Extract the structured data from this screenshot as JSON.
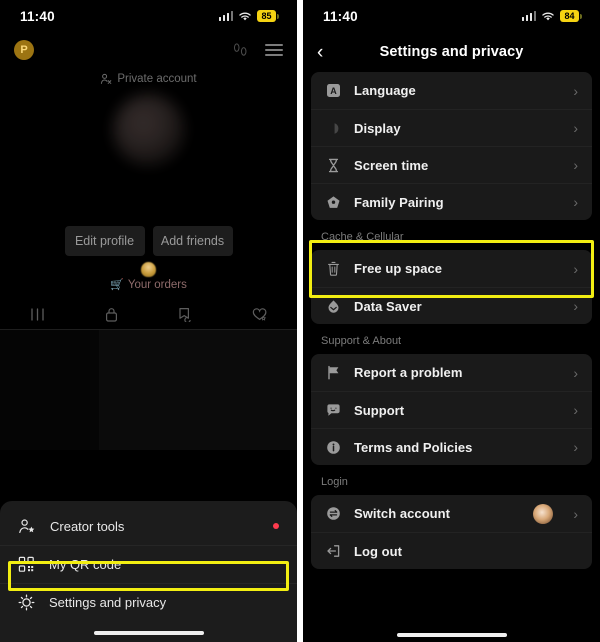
{
  "left_screen": {
    "status_bar": {
      "time": "11:40",
      "battery_level": "85",
      "battery_color": "#f5d312",
      "signal_icon": "cellular-bars-icon",
      "wifi_icon": "wifi-icon"
    },
    "header": {
      "badge_letter": "P",
      "username_redacted": "",
      "footprints_icon": "footprints-icon",
      "menu_icon": "hamburger-menu-icon"
    },
    "private_account_label": "Private account",
    "buttons": {
      "edit_profile": "Edit profile",
      "add_friends": "Add friends"
    },
    "orders_label": "Your orders",
    "tabs": [
      {
        "name": "posts-tab",
        "icon": "grid-icon"
      },
      {
        "name": "private-tab",
        "icon": "lock-icon"
      },
      {
        "name": "reposts-tab",
        "icon": "repost-icon"
      },
      {
        "name": "liked-tab",
        "icon": "heart-icon"
      }
    ],
    "sheet": {
      "items": [
        {
          "label": "Creator tools",
          "icon": "person-star-icon",
          "badge": true
        },
        {
          "label": "My QR code",
          "icon": "qr-code-icon",
          "badge": false
        },
        {
          "label": "Settings and privacy",
          "icon": "gear-icon",
          "badge": false
        }
      ]
    },
    "highlight_color": "#f2ee12"
  },
  "right_screen": {
    "status_bar": {
      "time": "11:40",
      "battery_level": "84",
      "battery_color": "#f5d312"
    },
    "nav": {
      "back_icon": "chevron-left-icon",
      "title": "Settings and privacy"
    },
    "groups": [
      {
        "header": "",
        "rows": [
          {
            "label": "Language",
            "icon": "language-letter-a-icon",
            "chevron": "›"
          },
          {
            "label": "Display",
            "icon": "moon-display-icon",
            "chevron": "›"
          },
          {
            "label": "Screen time",
            "icon": "hourglass-icon",
            "chevron": "›"
          },
          {
            "label": "Family Pairing",
            "icon": "home-family-icon",
            "chevron": "›"
          }
        ]
      },
      {
        "header": "Cache & Cellular",
        "rows": [
          {
            "label": "Free up space",
            "icon": "trash-icon",
            "chevron": "›"
          },
          {
            "label": "Data Saver",
            "icon": "droplet-icon",
            "chevron": "›"
          }
        ]
      },
      {
        "header": "Support & About",
        "rows": [
          {
            "label": "Report a problem",
            "icon": "flag-icon",
            "chevron": "›"
          },
          {
            "label": "Support",
            "icon": "chat-bubble-icon",
            "chevron": "›"
          },
          {
            "label": "Terms and Policies",
            "icon": "info-circle-icon",
            "chevron": "›"
          }
        ]
      },
      {
        "header": "Login",
        "rows": [
          {
            "label": "Switch account",
            "icon": "switch-arrows-icon",
            "chevron": "›",
            "avatar": true
          },
          {
            "label": "Log out",
            "icon": "logout-icon",
            "chevron": ""
          }
        ]
      }
    ],
    "highlight_color": "#f2ee12",
    "highlighted_section": "Cache & Cellular"
  }
}
